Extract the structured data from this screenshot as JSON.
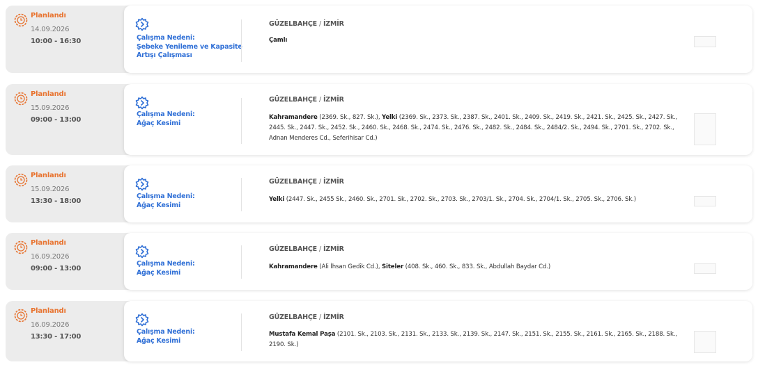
{
  "items": [
    {
      "status": "Planlandı",
      "date": "14.09.2026",
      "time": "10:00 - 16:30",
      "reason_label": "Çalışma Nedeni:",
      "reason": "Şebeke Yenileme ve Kapasite Artışı Çalışması",
      "district": "GÜZELBAHÇE",
      "city": "İZMİR",
      "separator": "/",
      "streets": [
        {
          "name": "Çamlı",
          "detail": ""
        }
      ]
    },
    {
      "status": "Planlandı",
      "date": "15.09.2026",
      "time": "09:00 - 13:00",
      "reason_label": "Çalışma Nedeni:",
      "reason": "Ağaç Kesimi",
      "district": "GÜZELBAHÇE",
      "city": "İZMİR",
      "separator": "/",
      "streets": [
        {
          "name": "Kahramandere",
          "detail": " (2369. Sk., 827. Sk.), "
        },
        {
          "name": "Yelki",
          "detail": " (2369. Sk., 2373. Sk., 2387. Sk., 2401. Sk., 2409. Sk., 2419. Sk., 2421. Sk., 2425. Sk., 2427. Sk., 2445. Sk., 2447. Sk., 2452. Sk., 2460. Sk., 2468. Sk., 2474. Sk., 2476. Sk., 2482. Sk., 2484. Sk., 2484/2. Sk., 2494. Sk., 2701. Sk., 2702. Sk., Adnan Menderes Cd., Seferihisar Cd.)"
        }
      ]
    },
    {
      "status": "Planlandı",
      "date": "15.09.2026",
      "time": "13:30 - 18:00",
      "reason_label": "Çalışma Nedeni:",
      "reason": "Ağaç Kesimi",
      "district": "GÜZELBAHÇE",
      "city": "İZMİR",
      "separator": "/",
      "streets": [
        {
          "name": "Yelki",
          "detail": " (2447. Sk., 2455 Sk., 2460. Sk., 2701. Sk., 2702. Sk., 2703. Sk., 2703/1. Sk., 2704. Sk., 2704/1. Sk., 2705. Sk., 2706. Sk.)"
        }
      ]
    },
    {
      "status": "Planlandı",
      "date": "16.09.2026",
      "time": "09:00 - 13:00",
      "reason_label": "Çalışma Nedeni:",
      "reason": "Ağaç Kesimi",
      "district": "GÜZELBAHÇE",
      "city": "İZMİR",
      "separator": "/",
      "streets": [
        {
          "name": "Kahramandere",
          "detail": " (Ali İhsan Gedik Cd.), "
        },
        {
          "name": "Siteler",
          "detail": " (408. Sk., 460. Sk., 833. Sk., Abdullah Baydar Cd.)"
        }
      ]
    },
    {
      "status": "Planlandı",
      "date": "16.09.2026",
      "time": "13:30 - 17:00",
      "reason_label": "Çalışma Nedeni:",
      "reason": "Ağaç Kesimi",
      "district": "GÜZELBAHÇE",
      "city": "İZMİR",
      "separator": "/",
      "streets": [
        {
          "name": "Mustafa Kemal Paşa",
          "detail": " (2101. Sk., 2103. Sk., 2131. Sk., 2133. Sk., 2139. Sk., 2147. Sk., 2151. Sk., 2155. Sk., 2161. Sk., 2165. Sk., 2188. Sk., 2190. Sk.)"
        }
      ]
    }
  ],
  "colors": {
    "status": "#e8732f",
    "reason": "#2f6fd6",
    "left_panel": "#ececec"
  },
  "icons": {
    "status": "clock-gear-icon",
    "reason": "maintenance-gear-icon"
  }
}
